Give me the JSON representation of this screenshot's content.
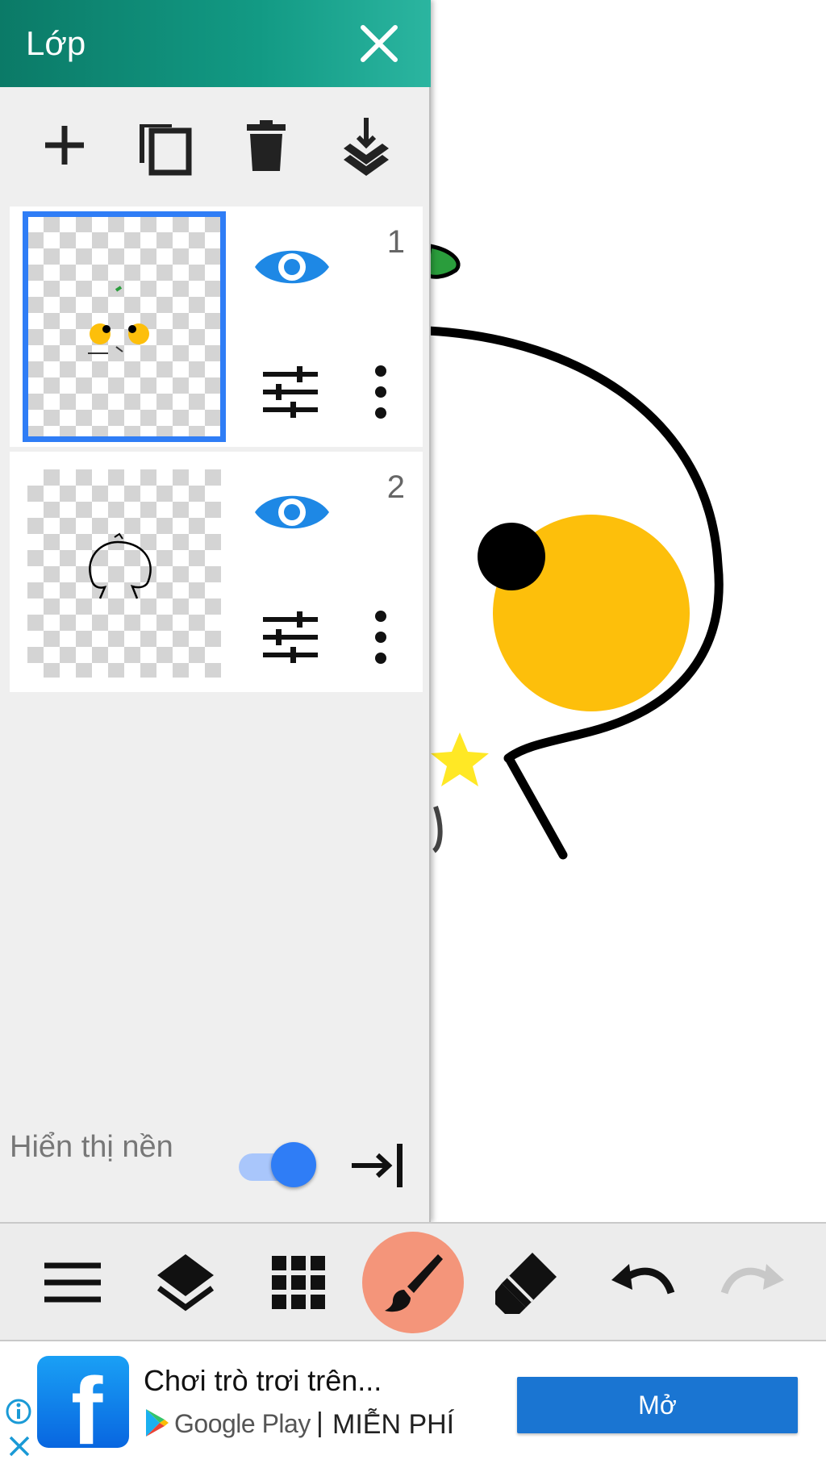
{
  "layer_panel": {
    "title": "Lớp",
    "toolbar": [
      "add-icon",
      "duplicate-icon",
      "delete-icon",
      "merge-down-icon"
    ],
    "layers": [
      {
        "number": "1",
        "visible": true,
        "selected": true
      },
      {
        "number": "2",
        "visible": true,
        "selected": false
      }
    ],
    "background_label": "Hiển thị nền",
    "background_toggle_on": true
  },
  "bottom_toolbar": [
    "menu-icon",
    "layers-icon",
    "grid-icon",
    "brush-icon",
    "eraser-icon",
    "undo-icon",
    "redo-icon"
  ],
  "ad": {
    "title": "Chơi trò trơi trên...",
    "store": "Google Play",
    "separator": "|",
    "price": "MIỄN PHÍ",
    "open_label": "Mở"
  },
  "colors": {
    "header": "#129a84",
    "accent_blue": "#2f7df6",
    "brush_highlight": "#f4957a",
    "yellow": "#fdbf0b",
    "ad_button": "#1a75d2"
  }
}
